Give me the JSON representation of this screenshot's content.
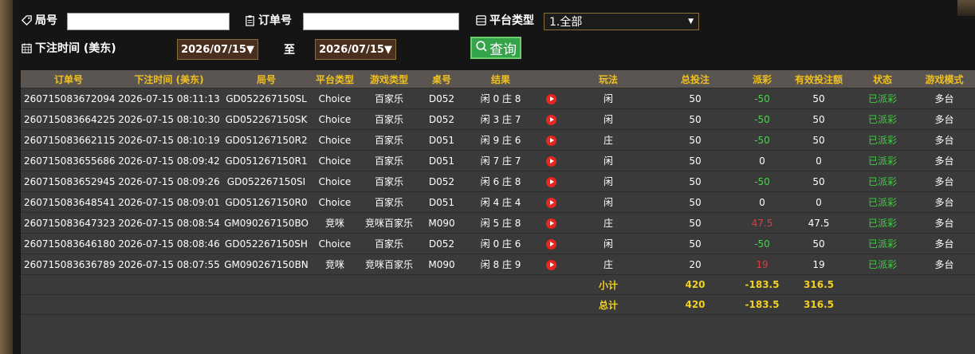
{
  "filters": {
    "round_label": "局号",
    "round_value": "",
    "order_label": "订单号",
    "order_value": "",
    "platform_label": "平台类型",
    "platform_selected": "1.全部",
    "bet_time_label": "下注时间 (美东)",
    "date_from": "2026/07/15▼",
    "to_label": "至",
    "date_to": "2026/07/15▼",
    "query_label": "查询"
  },
  "table": {
    "headers": [
      "订单号",
      "下注时间 (美东)",
      "局号",
      "平台类型",
      "游戏类型",
      "桌号",
      "结果",
      "",
      "玩法",
      "总投注",
      "派彩",
      "有效投注额",
      "状态",
      "游戏模式"
    ],
    "rows": [
      {
        "order": "260715083672094",
        "time": "2026-07-15 08:11:13",
        "round": "GD052267150SL",
        "platform": "Choice",
        "game": "百家乐",
        "table": "D052",
        "result": "闲 0 庄 8",
        "play": "闲",
        "bet": "50",
        "payout": "-50",
        "payout_type": "pos",
        "valid": "50",
        "status": "已派彩",
        "mode": "多台"
      },
      {
        "order": "260715083664225",
        "time": "2026-07-15 08:10:30",
        "round": "GD052267150SK",
        "platform": "Choice",
        "game": "百家乐",
        "table": "D052",
        "result": "闲 3 庄 7",
        "play": "闲",
        "bet": "50",
        "payout": "-50",
        "payout_type": "pos",
        "valid": "50",
        "status": "已派彩",
        "mode": "多台"
      },
      {
        "order": "260715083662115",
        "time": "2026-07-15 08:10:19",
        "round": "GD051267150R2",
        "platform": "Choice",
        "game": "百家乐",
        "table": "D051",
        "result": "闲 9 庄 6",
        "play": "庄",
        "bet": "50",
        "payout": "-50",
        "payout_type": "pos",
        "valid": "50",
        "status": "已派彩",
        "mode": "多台"
      },
      {
        "order": "260715083655686",
        "time": "2026-07-15 08:09:42",
        "round": "GD051267150R1",
        "platform": "Choice",
        "game": "百家乐",
        "table": "D051",
        "result": "闲 7 庄 7",
        "play": "闲",
        "bet": "50",
        "payout": "0",
        "payout_type": "zero",
        "valid": "0",
        "status": "已派彩",
        "mode": "多台"
      },
      {
        "order": "260715083652945",
        "time": "2026-07-15 08:09:26",
        "round": "GD052267150SI",
        "platform": "Choice",
        "game": "百家乐",
        "table": "D052",
        "result": "闲 6 庄 8",
        "play": "闲",
        "bet": "50",
        "payout": "-50",
        "payout_type": "pos",
        "valid": "50",
        "status": "已派彩",
        "mode": "多台"
      },
      {
        "order": "260715083648541",
        "time": "2026-07-15 08:09:01",
        "round": "GD051267150R0",
        "platform": "Choice",
        "game": "百家乐",
        "table": "D051",
        "result": "闲 4 庄 4",
        "play": "闲",
        "bet": "50",
        "payout": "0",
        "payout_type": "zero",
        "valid": "0",
        "status": "已派彩",
        "mode": "多台"
      },
      {
        "order": "260715083647323",
        "time": "2026-07-15 08:08:54",
        "round": "GM090267150BO",
        "platform": "竞咪",
        "game": "竞咪百家乐",
        "table": "M090",
        "result": "闲 5 庄 8",
        "play": "庄",
        "bet": "50",
        "payout": "47.5",
        "payout_type": "neg",
        "valid": "47.5",
        "status": "已派彩",
        "mode": "多台"
      },
      {
        "order": "260715083646180",
        "time": "2026-07-15 08:08:46",
        "round": "GD052267150SH",
        "platform": "Choice",
        "game": "百家乐",
        "table": "D052",
        "result": "闲 0 庄 6",
        "play": "闲",
        "bet": "50",
        "payout": "-50",
        "payout_type": "pos",
        "valid": "50",
        "status": "已派彩",
        "mode": "多台"
      },
      {
        "order": "260715083636789",
        "time": "2026-07-15 08:07:55",
        "round": "GM090267150BN",
        "platform": "竞咪",
        "game": "竞咪百家乐",
        "table": "M090",
        "result": "闲 8 庄 9",
        "play": "庄",
        "bet": "20",
        "payout": "19",
        "payout_type": "neg",
        "valid": "19",
        "status": "已派彩",
        "mode": "多台"
      }
    ],
    "subtotal": {
      "label": "小计",
      "bet": "420",
      "payout": "-183.5",
      "valid": "316.5"
    },
    "total": {
      "label": "总计",
      "bet": "420",
      "payout": "-183.5",
      "valid": "316.5"
    }
  },
  "colors": {
    "header_text": "#f0c020",
    "positive_payout": "#49d449",
    "negative_payout": "#e23b3b",
    "status_text": "#3fcf3f",
    "query_button": "#34a34a"
  }
}
